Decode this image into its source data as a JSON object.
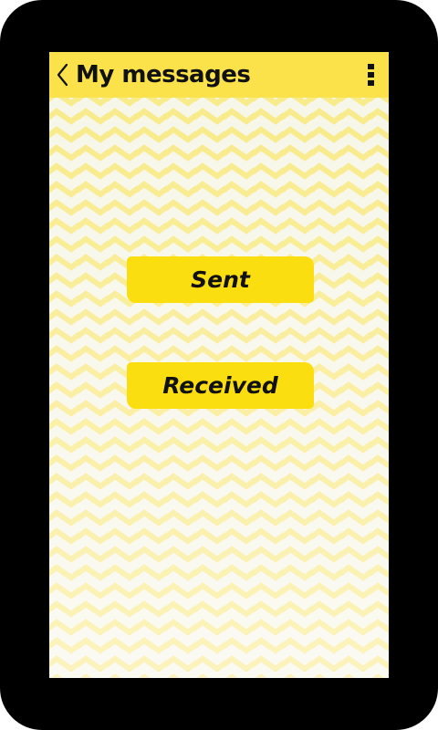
{
  "header": {
    "title": "My messages",
    "back_icon": "chevron-left-icon",
    "menu_icon": "vertical-dots-icon"
  },
  "main": {
    "sent_label": "Sent",
    "received_label": "Received"
  },
  "colors": {
    "header_bg": "#fbe14a",
    "button_bg": "#fbde0f",
    "pattern_stripe": "#f8ea86",
    "pattern_bg": "#f6f6e8",
    "frame": "#000000"
  }
}
